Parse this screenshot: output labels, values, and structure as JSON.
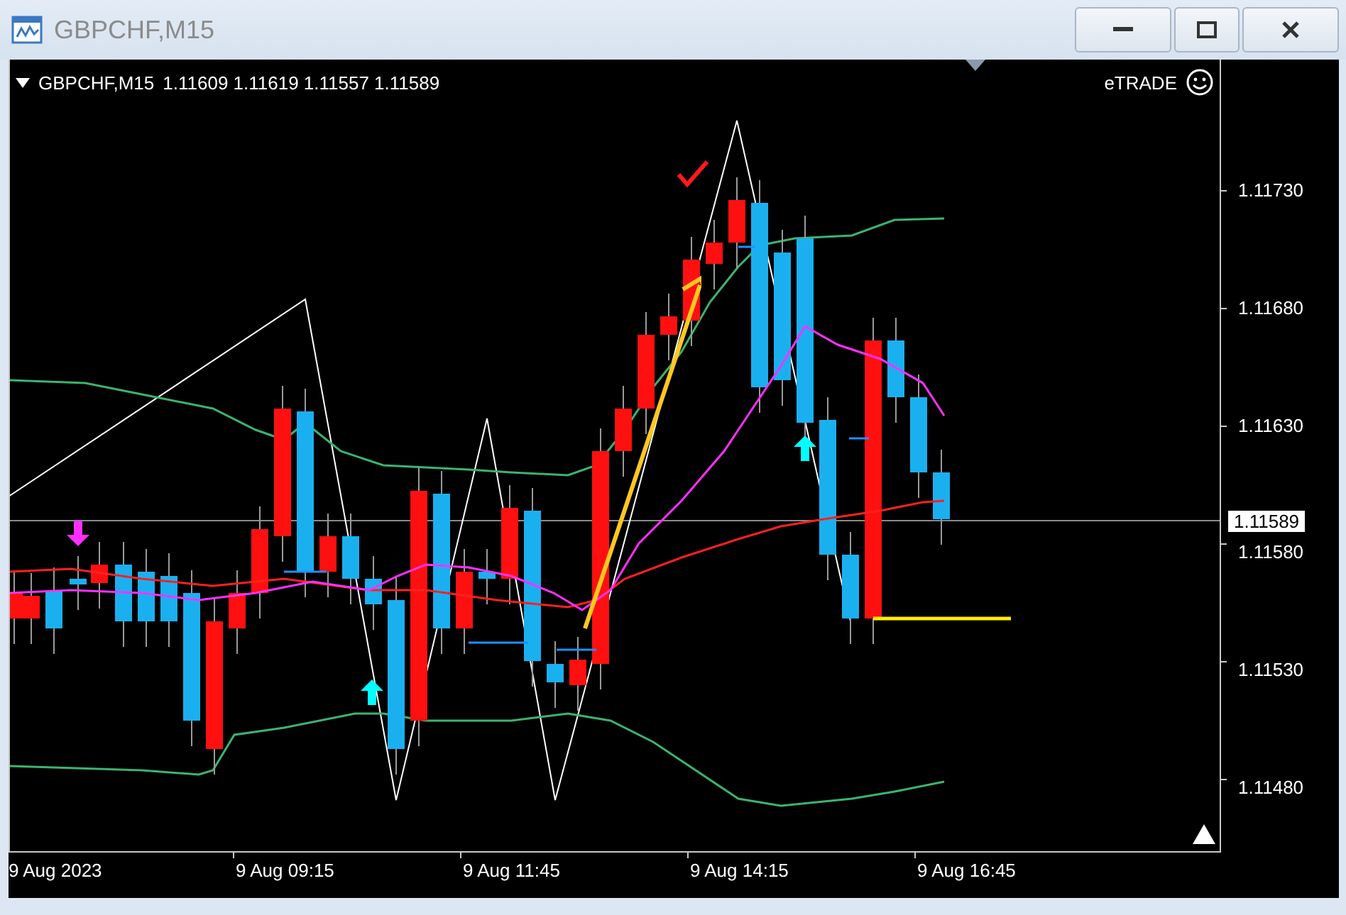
{
  "window": {
    "title": "GBPCHF,M15"
  },
  "chart_header": {
    "symbol": "GBPCHF,M15",
    "ohlc": "1.11609 1.11619 1.11557 1.11589",
    "broker": "eTRADE"
  },
  "price_axis": {
    "ticks": [
      "1.11730",
      "1.11680",
      "1.11630",
      "1.11580",
      "1.11530",
      "1.11480"
    ],
    "current_price": "1.11589"
  },
  "time_axis": {
    "labels": [
      "9 Aug 2023",
      "9 Aug 09:15",
      "9 Aug 11:45",
      "9 Aug 14:15",
      "9 Aug 16:45"
    ]
  }
}
